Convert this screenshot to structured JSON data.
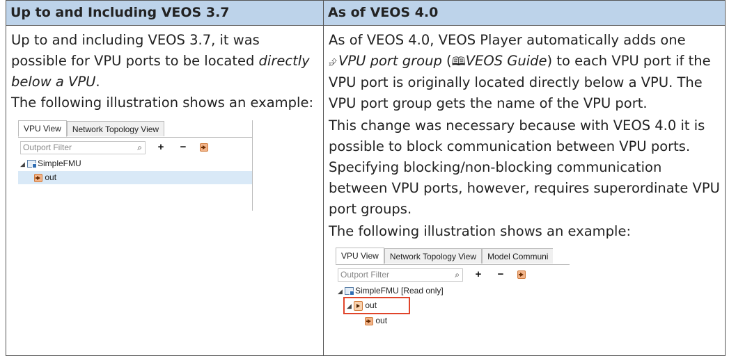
{
  "table": {
    "header": {
      "col1": "Up to and Including VEOS 3.7",
      "col2": "As of VEOS 4.0"
    },
    "left": {
      "p1_prefix": "Up to and including VEOS 3.7, it was possible for VPU ports to be located ",
      "p1_emph": "directly below a VPU",
      "p1_suffix": ".",
      "p2": "The following illustration shows an example:"
    },
    "right": {
      "p1_prefix": "As of VEOS 4.0, VEOS Player automatically adds one ",
      "p1_link": "VPU port group",
      "p1_ref_open": " (",
      "p1_ref": "VEOS Guide",
      "p1_suffix": ") to each VPU port if the VPU port is originally located directly below a VPU. The VPU port group gets the name of the VPU port.",
      "p2": "This change was necessary because with VEOS 4.0 it is possible to block communication between VPU ports. Specifying blocking/non-blocking communication between VPU ports, however, requires superordinate VPU port groups.",
      "p3": "The following illustration shows an example:"
    }
  },
  "icons": {
    "xref": "cross-reference-icon",
    "book": "book-icon"
  },
  "shot_left": {
    "tabs": [
      "VPU View",
      "Network Topology View"
    ],
    "filter_placeholder": "Outport Filter",
    "toolbar": [
      "+",
      "−"
    ],
    "tree": {
      "root": "SimpleFMU",
      "child": "out"
    }
  },
  "shot_right": {
    "tabs": [
      "VPU View",
      "Network Topology View",
      "Model Communi"
    ],
    "filter_placeholder": "Outport Filter",
    "toolbar": [
      "+",
      "−"
    ],
    "tree": {
      "root": "SimpleFMU [Read only]",
      "group": "out",
      "port": "out"
    },
    "highlight_color": "#e0442a"
  }
}
